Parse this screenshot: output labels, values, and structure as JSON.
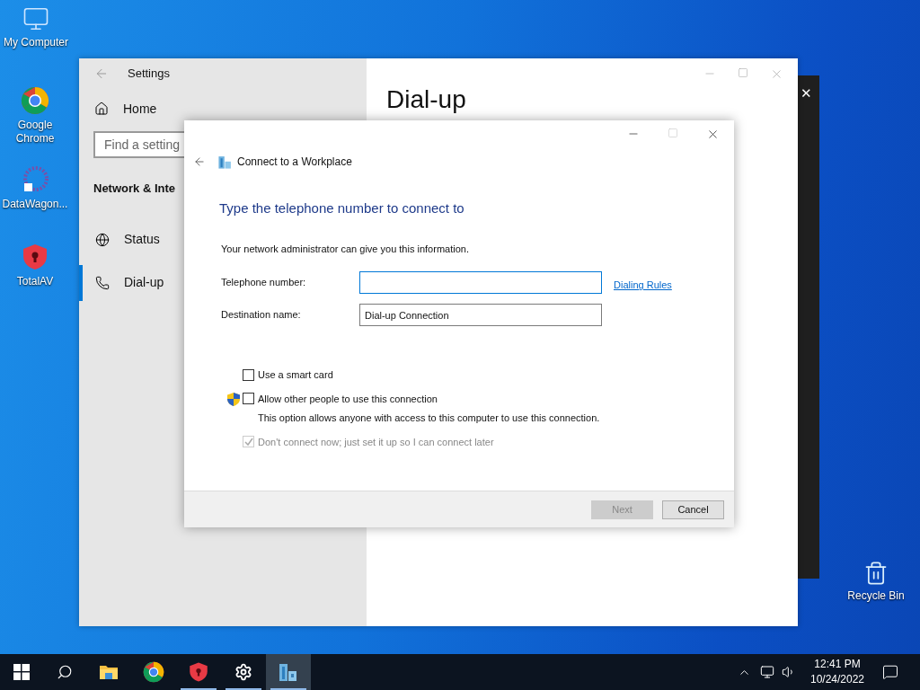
{
  "desktop_icons": [
    {
      "label": "My Computer"
    },
    {
      "label": "Google Chrome"
    },
    {
      "label": "DataWagon..."
    },
    {
      "label": "TotalAV"
    },
    {
      "label": "Recycle Bin"
    }
  ],
  "back_window": {
    "close": "✕"
  },
  "settings": {
    "title": "Settings",
    "nav": [
      {
        "label": "Home",
        "selected": false
      }
    ],
    "search": {
      "placeholder": "Find a setting"
    },
    "section": "Network & Inte",
    "items": [
      {
        "label": "Status",
        "selected": false
      },
      {
        "label": "Dial-up",
        "selected": true
      }
    ],
    "heading": "Dial-up"
  },
  "dialog": {
    "title": "Connect to a Workplace",
    "heading": "Type the telephone number to connect to",
    "info": "Your network administrator can give you this information.",
    "fields": [
      {
        "label": "Telephone number:",
        "focused": true
      },
      {
        "label": "Destination name:",
        "value": "Dial-up Connection",
        "focused": false
      }
    ],
    "link": "Dialing Rules",
    "checkboxes": [
      {
        "label": "Use a smart card",
        "checked": false,
        "disabled": false,
        "shield": false
      },
      {
        "label": "Allow other people to use this connection",
        "checked": false,
        "disabled": false,
        "shield": true,
        "description": "This option allows anyone with access to this computer to use this connection."
      },
      {
        "label": "Don't connect now; just set it up so I can connect later",
        "checked": true,
        "disabled": true,
        "shield": false
      }
    ],
    "buttons": [
      {
        "label": "Next",
        "disabled": true
      },
      {
        "label": "Cancel",
        "disabled": false
      }
    ]
  },
  "taskbar": {
    "apps": [
      {
        "selected": false,
        "running": false
      },
      {
        "selected": false,
        "running": false
      },
      {
        "selected": false,
        "running": true
      },
      {
        "selected": false,
        "running": true
      },
      {
        "selected": true,
        "running": true
      }
    ],
    "time": "12:41 PM",
    "date": "10/24/2022"
  }
}
